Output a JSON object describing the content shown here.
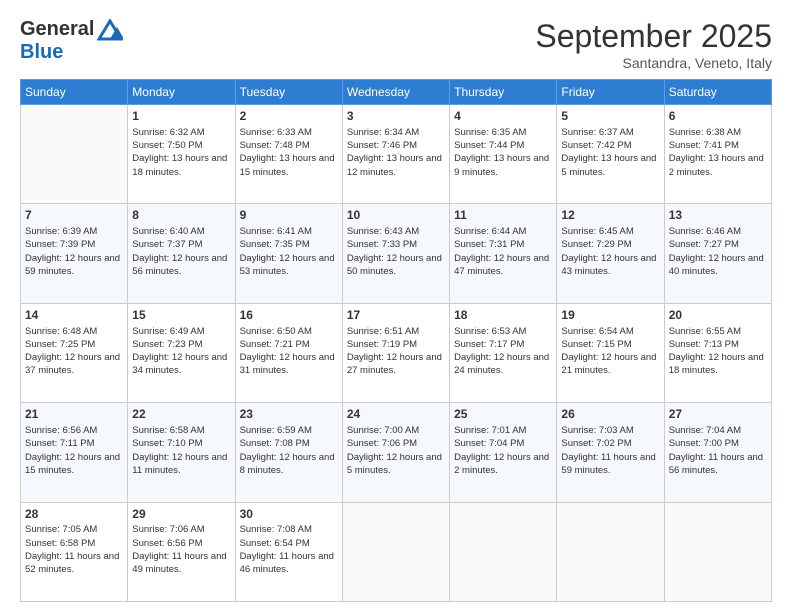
{
  "header": {
    "logo_line1": "General",
    "logo_line2": "Blue",
    "month": "September 2025",
    "location": "Santandra, Veneto, Italy"
  },
  "weekdays": [
    "Sunday",
    "Monday",
    "Tuesday",
    "Wednesday",
    "Thursday",
    "Friday",
    "Saturday"
  ],
  "weeks": [
    [
      {
        "day": "",
        "sunrise": "",
        "sunset": "",
        "daylight": ""
      },
      {
        "day": "1",
        "sunrise": "Sunrise: 6:32 AM",
        "sunset": "Sunset: 7:50 PM",
        "daylight": "Daylight: 13 hours and 18 minutes."
      },
      {
        "day": "2",
        "sunrise": "Sunrise: 6:33 AM",
        "sunset": "Sunset: 7:48 PM",
        "daylight": "Daylight: 13 hours and 15 minutes."
      },
      {
        "day": "3",
        "sunrise": "Sunrise: 6:34 AM",
        "sunset": "Sunset: 7:46 PM",
        "daylight": "Daylight: 13 hours and 12 minutes."
      },
      {
        "day": "4",
        "sunrise": "Sunrise: 6:35 AM",
        "sunset": "Sunset: 7:44 PM",
        "daylight": "Daylight: 13 hours and 9 minutes."
      },
      {
        "day": "5",
        "sunrise": "Sunrise: 6:37 AM",
        "sunset": "Sunset: 7:42 PM",
        "daylight": "Daylight: 13 hours and 5 minutes."
      },
      {
        "day": "6",
        "sunrise": "Sunrise: 6:38 AM",
        "sunset": "Sunset: 7:41 PM",
        "daylight": "Daylight: 13 hours and 2 minutes."
      }
    ],
    [
      {
        "day": "7",
        "sunrise": "Sunrise: 6:39 AM",
        "sunset": "Sunset: 7:39 PM",
        "daylight": "Daylight: 12 hours and 59 minutes."
      },
      {
        "day": "8",
        "sunrise": "Sunrise: 6:40 AM",
        "sunset": "Sunset: 7:37 PM",
        "daylight": "Daylight: 12 hours and 56 minutes."
      },
      {
        "day": "9",
        "sunrise": "Sunrise: 6:41 AM",
        "sunset": "Sunset: 7:35 PM",
        "daylight": "Daylight: 12 hours and 53 minutes."
      },
      {
        "day": "10",
        "sunrise": "Sunrise: 6:43 AM",
        "sunset": "Sunset: 7:33 PM",
        "daylight": "Daylight: 12 hours and 50 minutes."
      },
      {
        "day": "11",
        "sunrise": "Sunrise: 6:44 AM",
        "sunset": "Sunset: 7:31 PM",
        "daylight": "Daylight: 12 hours and 47 minutes."
      },
      {
        "day": "12",
        "sunrise": "Sunrise: 6:45 AM",
        "sunset": "Sunset: 7:29 PM",
        "daylight": "Daylight: 12 hours and 43 minutes."
      },
      {
        "day": "13",
        "sunrise": "Sunrise: 6:46 AM",
        "sunset": "Sunset: 7:27 PM",
        "daylight": "Daylight: 12 hours and 40 minutes."
      }
    ],
    [
      {
        "day": "14",
        "sunrise": "Sunrise: 6:48 AM",
        "sunset": "Sunset: 7:25 PM",
        "daylight": "Daylight: 12 hours and 37 minutes."
      },
      {
        "day": "15",
        "sunrise": "Sunrise: 6:49 AM",
        "sunset": "Sunset: 7:23 PM",
        "daylight": "Daylight: 12 hours and 34 minutes."
      },
      {
        "day": "16",
        "sunrise": "Sunrise: 6:50 AM",
        "sunset": "Sunset: 7:21 PM",
        "daylight": "Daylight: 12 hours and 31 minutes."
      },
      {
        "day": "17",
        "sunrise": "Sunrise: 6:51 AM",
        "sunset": "Sunset: 7:19 PM",
        "daylight": "Daylight: 12 hours and 27 minutes."
      },
      {
        "day": "18",
        "sunrise": "Sunrise: 6:53 AM",
        "sunset": "Sunset: 7:17 PM",
        "daylight": "Daylight: 12 hours and 24 minutes."
      },
      {
        "day": "19",
        "sunrise": "Sunrise: 6:54 AM",
        "sunset": "Sunset: 7:15 PM",
        "daylight": "Daylight: 12 hours and 21 minutes."
      },
      {
        "day": "20",
        "sunrise": "Sunrise: 6:55 AM",
        "sunset": "Sunset: 7:13 PM",
        "daylight": "Daylight: 12 hours and 18 minutes."
      }
    ],
    [
      {
        "day": "21",
        "sunrise": "Sunrise: 6:56 AM",
        "sunset": "Sunset: 7:11 PM",
        "daylight": "Daylight: 12 hours and 15 minutes."
      },
      {
        "day": "22",
        "sunrise": "Sunrise: 6:58 AM",
        "sunset": "Sunset: 7:10 PM",
        "daylight": "Daylight: 12 hours and 11 minutes."
      },
      {
        "day": "23",
        "sunrise": "Sunrise: 6:59 AM",
        "sunset": "Sunset: 7:08 PM",
        "daylight": "Daylight: 12 hours and 8 minutes."
      },
      {
        "day": "24",
        "sunrise": "Sunrise: 7:00 AM",
        "sunset": "Sunset: 7:06 PM",
        "daylight": "Daylight: 12 hours and 5 minutes."
      },
      {
        "day": "25",
        "sunrise": "Sunrise: 7:01 AM",
        "sunset": "Sunset: 7:04 PM",
        "daylight": "Daylight: 12 hours and 2 minutes."
      },
      {
        "day": "26",
        "sunrise": "Sunrise: 7:03 AM",
        "sunset": "Sunset: 7:02 PM",
        "daylight": "Daylight: 11 hours and 59 minutes."
      },
      {
        "day": "27",
        "sunrise": "Sunrise: 7:04 AM",
        "sunset": "Sunset: 7:00 PM",
        "daylight": "Daylight: 11 hours and 56 minutes."
      }
    ],
    [
      {
        "day": "28",
        "sunrise": "Sunrise: 7:05 AM",
        "sunset": "Sunset: 6:58 PM",
        "daylight": "Daylight: 11 hours and 52 minutes."
      },
      {
        "day": "29",
        "sunrise": "Sunrise: 7:06 AM",
        "sunset": "Sunset: 6:56 PM",
        "daylight": "Daylight: 11 hours and 49 minutes."
      },
      {
        "day": "30",
        "sunrise": "Sunrise: 7:08 AM",
        "sunset": "Sunset: 6:54 PM",
        "daylight": "Daylight: 11 hours and 46 minutes."
      },
      {
        "day": "",
        "sunrise": "",
        "sunset": "",
        "daylight": ""
      },
      {
        "day": "",
        "sunrise": "",
        "sunset": "",
        "daylight": ""
      },
      {
        "day": "",
        "sunrise": "",
        "sunset": "",
        "daylight": ""
      },
      {
        "day": "",
        "sunrise": "",
        "sunset": "",
        "daylight": ""
      }
    ]
  ]
}
